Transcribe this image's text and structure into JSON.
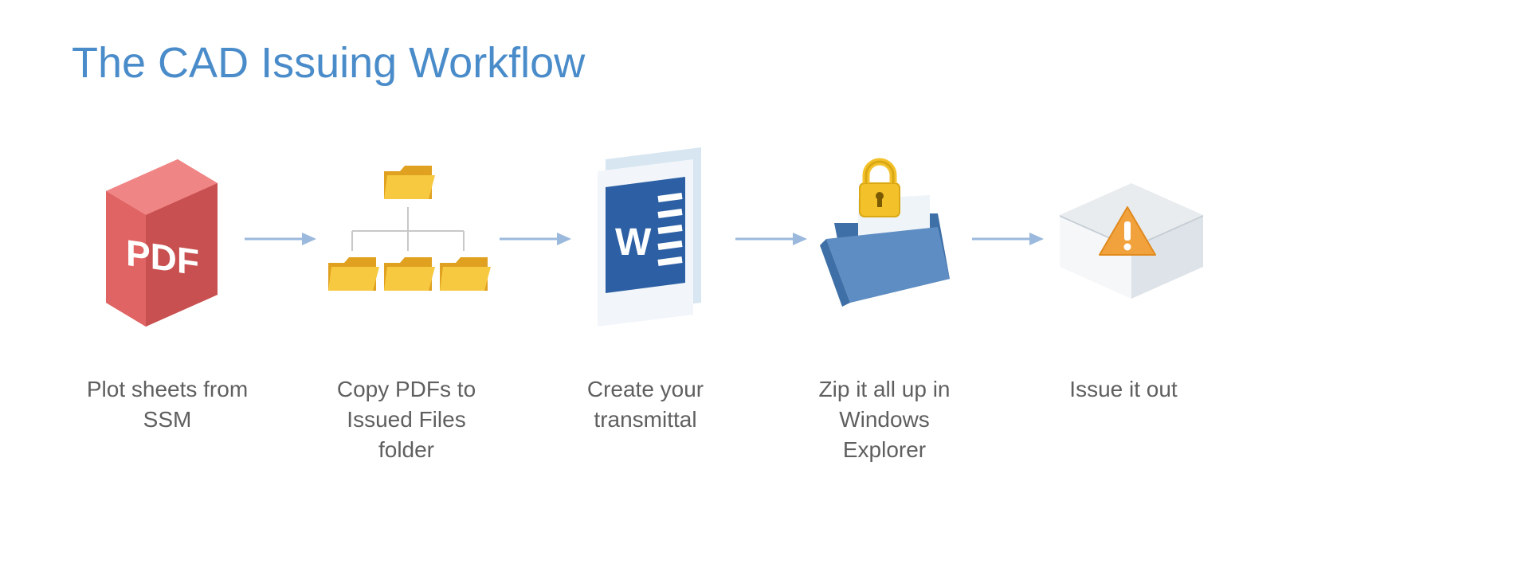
{
  "title": "The CAD Issuing Workflow",
  "steps": [
    {
      "icon": "pdf-doc-icon",
      "caption": "Plot sheets from SSM"
    },
    {
      "icon": "folder-tree-icon",
      "caption": "Copy PDFs to Issued Files folder"
    },
    {
      "icon": "word-doc-icon",
      "caption": "Create your transmittal"
    },
    {
      "icon": "locked-folder-icon",
      "caption": "Zip it all up in Windows Explorer"
    },
    {
      "icon": "envelope-alert-icon",
      "caption": "Issue it out"
    }
  ],
  "arrow_color": "#9BB9DC",
  "title_color": "#4A8CCA"
}
